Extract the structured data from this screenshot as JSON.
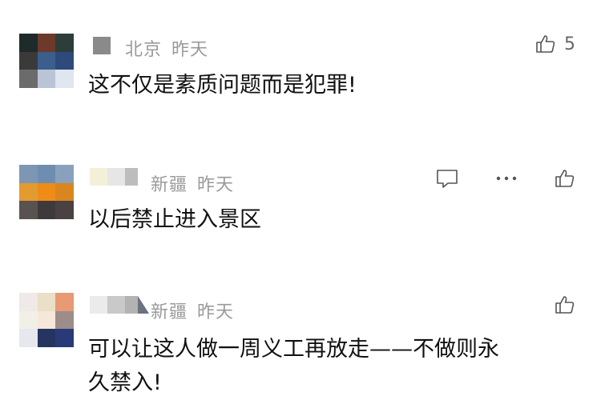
{
  "comments": [
    {
      "location": "北京",
      "time": "昨天",
      "like_count": "5",
      "text": "这不仅是素质问题而是犯罪!",
      "icons": [
        "thumbs-up-icon"
      ]
    },
    {
      "location": "新疆",
      "time": "昨天",
      "text": "以后禁止进入景区",
      "icons": [
        "reply-icon",
        "more-icon",
        "thumbs-up-icon"
      ]
    },
    {
      "location": "新疆",
      "time": "昨天",
      "text_line1": "可以让这人做一周义工再放走——不做则永",
      "text_line2": "久禁入!",
      "icons": [
        "thumbs-up-icon"
      ]
    }
  ]
}
